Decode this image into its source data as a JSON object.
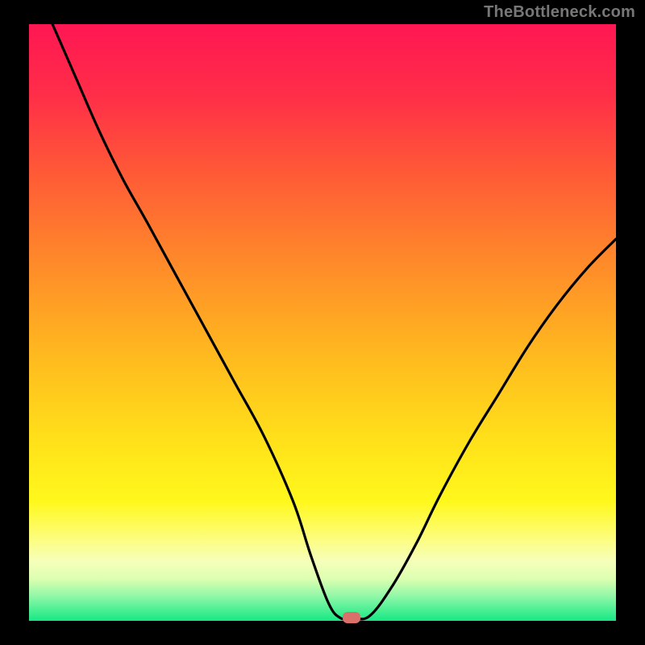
{
  "watermark": "TheBottleneck.com",
  "colors": {
    "frame": "#000000",
    "watermark": "#777777",
    "curve": "#000000",
    "marker": "#d9716a",
    "gradient_stops": [
      {
        "offset": 0.0,
        "color": "#ff1753"
      },
      {
        "offset": 0.12,
        "color": "#ff2e48"
      },
      {
        "offset": 0.25,
        "color": "#ff5a36"
      },
      {
        "offset": 0.4,
        "color": "#ff8a2a"
      },
      {
        "offset": 0.55,
        "color": "#ffb81f"
      },
      {
        "offset": 0.7,
        "color": "#ffe11a"
      },
      {
        "offset": 0.8,
        "color": "#fff81c"
      },
      {
        "offset": 0.86,
        "color": "#fdfd7a"
      },
      {
        "offset": 0.9,
        "color": "#f6ffba"
      },
      {
        "offset": 0.93,
        "color": "#dcffb0"
      },
      {
        "offset": 0.96,
        "color": "#8cf7a7"
      },
      {
        "offset": 1.0,
        "color": "#17e884"
      }
    ]
  },
  "chart_data": {
    "type": "line",
    "title": "",
    "xlabel": "",
    "ylabel": "",
    "xlim": [
      0,
      100
    ],
    "ylim": [
      0,
      100
    ],
    "grid": false,
    "series": [
      {
        "name": "bottleneck-curve",
        "x": [
          4,
          8,
          12,
          16,
          20,
          25,
          30,
          35,
          40,
          45,
          48,
          51,
          53,
          55,
          58,
          62,
          66,
          70,
          75,
          80,
          85,
          90,
          95,
          100
        ],
        "y": [
          100,
          91,
          82,
          74,
          67,
          58,
          49,
          40,
          31,
          20,
          11,
          3,
          0.5,
          0.5,
          0.8,
          6,
          13,
          21,
          30,
          38,
          46,
          53,
          59,
          64
        ]
      }
    ],
    "marker": {
      "x": 55,
      "y": 0.5
    }
  }
}
